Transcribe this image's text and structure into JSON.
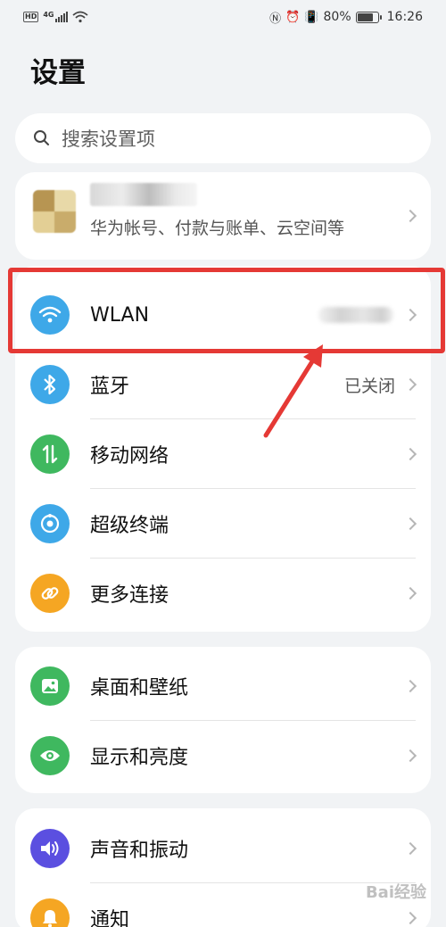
{
  "status_bar": {
    "hd": "HD",
    "network": "4G",
    "battery": "80%",
    "battery_level": 0.8,
    "time": "16:26"
  },
  "page": {
    "title": "设置"
  },
  "search": {
    "placeholder": "搜索设置项"
  },
  "account": {
    "subtitle": "华为帐号、付款与账单、云空间等"
  },
  "sections": [
    {
      "items": [
        {
          "label": "WLAN",
          "icon": "wifi-icon",
          "color": "#3ea8e8"
        },
        {
          "label": "蓝牙",
          "icon": "bluetooth-icon",
          "color": "#3ea8e8",
          "value": "已关闭"
        },
        {
          "label": "移动网络",
          "icon": "mobile-data-icon",
          "color": "#3fb85f"
        },
        {
          "label": "超级终端",
          "icon": "super-device-icon",
          "color": "#3ea8e8"
        },
        {
          "label": "更多连接",
          "icon": "link-icon",
          "color": "#f5a623"
        }
      ]
    },
    {
      "items": [
        {
          "label": "桌面和壁纸",
          "icon": "wallpaper-icon",
          "color": "#3fb85f"
        },
        {
          "label": "显示和亮度",
          "icon": "eye-icon",
          "color": "#3fb85f"
        }
      ]
    },
    {
      "items": [
        {
          "label": "声音和振动",
          "icon": "sound-icon",
          "color": "#5b4fe0"
        },
        {
          "label": "通知",
          "icon": "bell-icon",
          "color": "#f5a623"
        }
      ]
    }
  ],
  "annotation": {
    "highlight_color": "#e53935"
  },
  "watermark": "Bai经验"
}
